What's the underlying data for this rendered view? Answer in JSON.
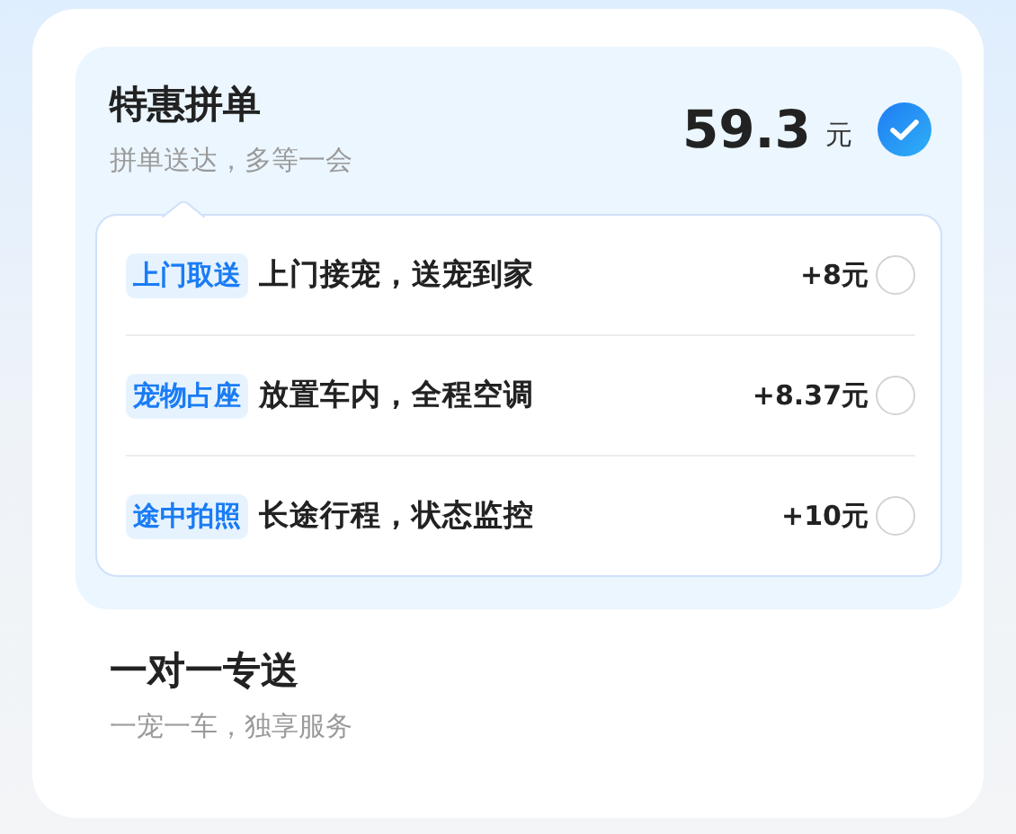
{
  "options": [
    {
      "title": "特惠拼单",
      "subtitle": "拼单送达，多等一会",
      "price": "59.3",
      "unit": "元",
      "selected": true,
      "addons": [
        {
          "tag": "上门取送",
          "description": "上门接宠，送宠到家",
          "price": "+8元",
          "selected": false
        },
        {
          "tag": "宠物占座",
          "description": "放置车内，全程空调",
          "price": "+8.37元",
          "selected": false
        },
        {
          "tag": "途中拍照",
          "description": "长途行程，状态监控",
          "price": "+10元",
          "selected": false
        }
      ]
    },
    {
      "title": "一对一专送",
      "subtitle": "一宠一车，独享服务",
      "selected": false
    }
  ]
}
